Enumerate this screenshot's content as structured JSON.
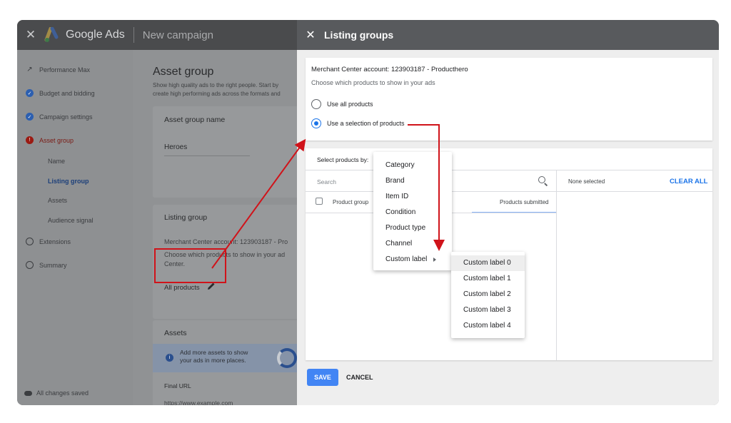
{
  "app": {
    "brand": "Google Ads",
    "campaign": "New campaign"
  },
  "sidebar": {
    "items": [
      {
        "label": "Performance Max",
        "state": "pm"
      },
      {
        "label": "Budget and bidding",
        "state": "done"
      },
      {
        "label": "Campaign settings",
        "state": "done"
      },
      {
        "label": "Asset group",
        "state": "error"
      },
      {
        "label": "Extensions",
        "state": "empty"
      },
      {
        "label": "Summary",
        "state": "empty"
      }
    ],
    "sub_items": [
      {
        "label": "Name"
      },
      {
        "label": "Listing group"
      },
      {
        "label": "Assets"
      },
      {
        "label": "Audience signal"
      }
    ],
    "status": "All changes saved"
  },
  "asset_group": {
    "title": "Asset group",
    "description_1": "Show high quality ads to the right people. Start by",
    "description_2": "create high performing ads across the formats and",
    "name_card": {
      "title": "Asset group name",
      "value": "Heroes"
    },
    "listing_card": {
      "title": "Listing group",
      "account": "Merchant Center account: 123903187 - Pro",
      "desc_1": "Choose which products to show in your ad",
      "desc_2": "Center.",
      "value": "All products"
    },
    "assets_card": {
      "title": "Assets",
      "info_1": "Add more assets to show",
      "info_2": "your ads in more places.",
      "final_url_label": "Final URL",
      "final_url_placeholder": "https://www.example.com"
    }
  },
  "panel": {
    "title": "Listing groups",
    "account": "Merchant Center account: 123903187 - Producthero",
    "subtitle": "Choose which products to show in your ads",
    "option_all": "Use all products",
    "option_selection": "Use a selection of products",
    "select_by": "Select products by:",
    "search_placeholder": "Search",
    "col_product_group": "Product group",
    "col_products_submitted": "Products submitted",
    "none_selected": "None selected",
    "clear_all": "CLEAR ALL",
    "save": "SAVE",
    "cancel": "CANCEL"
  },
  "dimension_menu": [
    "Category",
    "Brand",
    "Item ID",
    "Condition",
    "Product type",
    "Channel",
    "Custom label"
  ],
  "custom_label_menu": [
    "Custom label 0",
    "Custom label 1",
    "Custom label 2",
    "Custom label 3",
    "Custom label 4"
  ],
  "colors": {
    "accent": "#1a73e8",
    "annotation": "#d0131a",
    "save_button": "#4285f4"
  }
}
